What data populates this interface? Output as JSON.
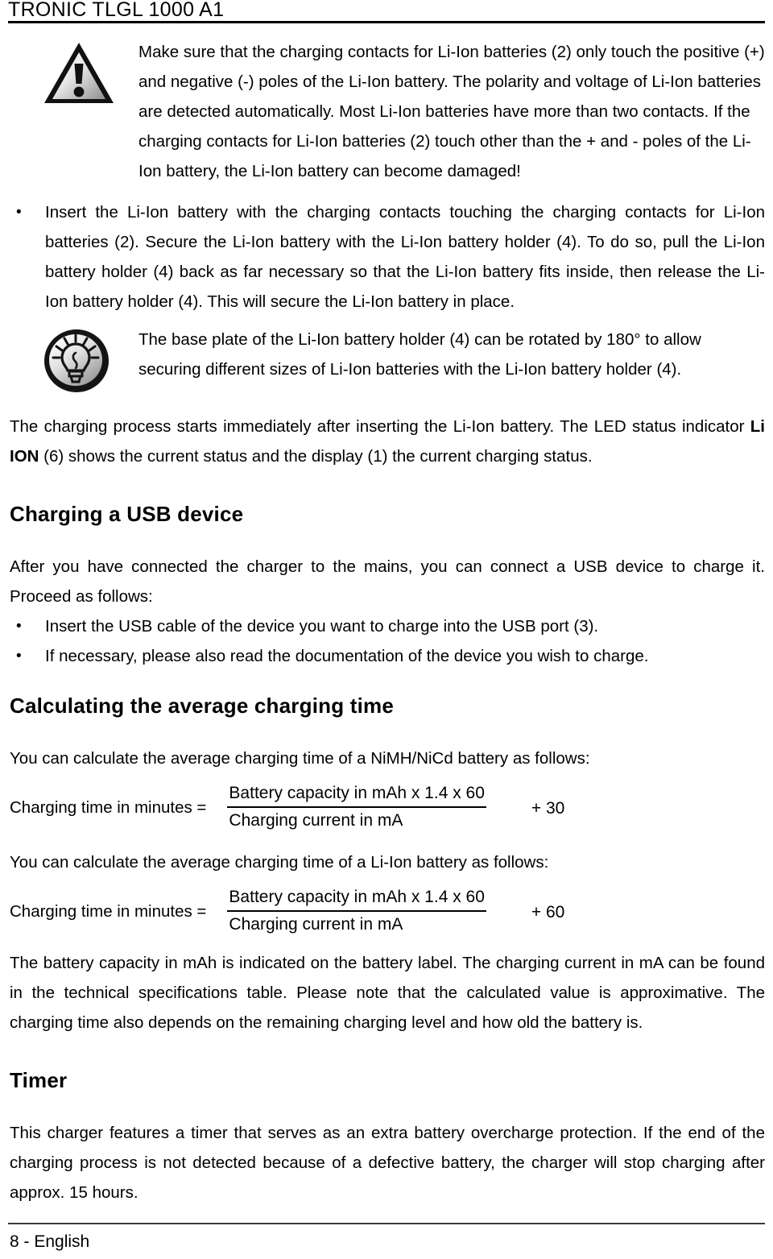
{
  "header": {
    "title": "TRONIC TLGL 1000 A1"
  },
  "warning_note": {
    "icon": "warning-triangle-icon",
    "text": "Make sure that the charging contacts for Li-Ion batteries (2) only touch the positive (+) and negative (-) poles of the Li-Ion battery. The polarity and voltage of Li-Ion batteries are detected automatically. Most Li-Ion batteries have more than two contacts. If the charging contacts for Li-Ion batteries (2) touch other than the + and - poles of the Li-Ion battery, the Li-Ion battery can become damaged!"
  },
  "insert_bullet": {
    "text": "Insert the Li-Ion battery with the charging contacts touching the charging contacts for Li-Ion batteries (2). Secure the Li-Ion battery with the Li-Ion battery holder (4). To do so, pull the Li-Ion battery holder (4) back as far necessary so that the Li-Ion battery fits inside, then release the Li-Ion battery holder (4). This will secure the Li-Ion battery in place."
  },
  "tip_note": {
    "icon": "lightbulb-tip-icon",
    "text": "The base plate of the Li-Ion battery holder (4) can be rotated by 180° to allow securing different sizes of Li-Ion batteries with the Li-Ion battery holder (4)."
  },
  "charging_process": {
    "part1": "The charging process starts immediately after inserting the Li-Ion battery. The LED status indicator ",
    "bold": "Li ION",
    "part2": " (6) shows the current status and the display (1) the current charging status."
  },
  "usb_section": {
    "heading": "Charging a USB device",
    "intro": "After you have connected the charger to the mains, you can connect a USB device to charge it. Proceed as follows:",
    "bullets": [
      "Insert the USB cable of the device you want to charge into the USB port (3).",
      "If necessary, please also read the documentation of the device you wish to charge."
    ]
  },
  "average_time_section": {
    "heading": "Calculating the average charging time",
    "intro_nimh": "You can calculate the average charging time of a NiMH/NiCd battery as follows:",
    "formula_nimh": {
      "label": "Charging time in minutes =",
      "numerator": "Battery capacity in mAh x 1.4 x 60",
      "denominator": "Charging current in mA",
      "addend": "+ 30"
    },
    "intro_liion": "You can calculate the average charging time of a Li-Ion battery as follows:",
    "formula_liion": {
      "label": "Charging time in minutes =",
      "numerator": "Battery capacity in mAh x 1.4 x 60",
      "denominator": "Charging current in mA",
      "addend": "+ 60"
    },
    "outro": "The battery capacity in mAh is indicated on the battery label. The charging current in mA can be found in the technical specifications table. Please note that the calculated value is approximative. The charging time also depends on the remaining charging level and how old the battery is."
  },
  "timer_section": {
    "heading": "Timer",
    "text": "This charger features a timer that serves as an extra battery overcharge protection. If the end of the charging process is not detected because of a defective battery, the charger will stop charging after approx. 15 hours."
  },
  "footer": {
    "page_label": "8 - English"
  },
  "colors": {
    "text": "#000000",
    "rule": "#000000",
    "footer_rule": "#3a3a3a",
    "background": "#ffffff"
  }
}
